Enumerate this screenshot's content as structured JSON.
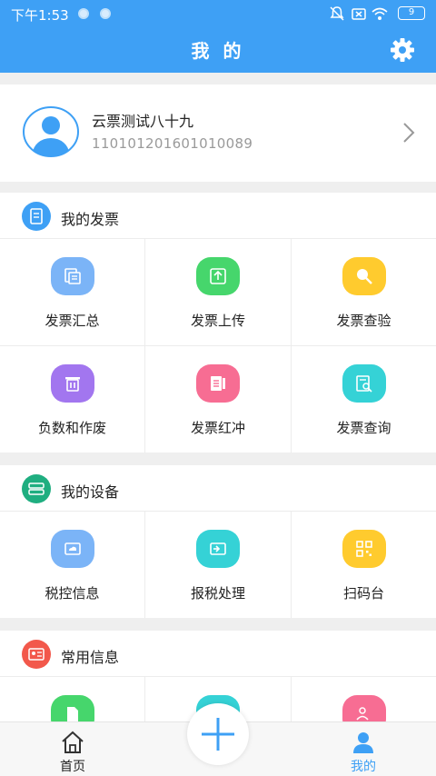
{
  "status_bar": {
    "time": "下午1:53",
    "battery": "9"
  },
  "header": {
    "title": "我 的"
  },
  "profile": {
    "name": "云票测试八十九",
    "id": "110101201601010089"
  },
  "sections": {
    "invoice": {
      "title": "我的发票",
      "items": [
        "发票汇总",
        "发票上传",
        "发票查验",
        "负数和作废",
        "发票红冲",
        "发票查询"
      ]
    },
    "device": {
      "title": "我的设备",
      "items": [
        "税控信息",
        "报税处理",
        "扫码台"
      ]
    },
    "common": {
      "title": "常用信息"
    }
  },
  "bottom_nav": {
    "home": "首页",
    "mine": "我的"
  },
  "colors": {
    "primary": "#3ea0f5",
    "blue_icon": "#7bb4f7",
    "green_icon": "#46d66c",
    "yellow_icon": "#ffcb2e",
    "purple_icon": "#a276ef",
    "pink_icon": "#f76d93",
    "cyan_icon": "#35d2d6",
    "red_icon": "#f2584b",
    "teal_icon": "#1fae80"
  },
  "icons": {
    "settings": "gear-icon",
    "avatar": "user-avatar-icon",
    "chevron": "chevron-right-icon",
    "home": "home-icon",
    "mine": "person-icon",
    "add": "plus-icon"
  }
}
